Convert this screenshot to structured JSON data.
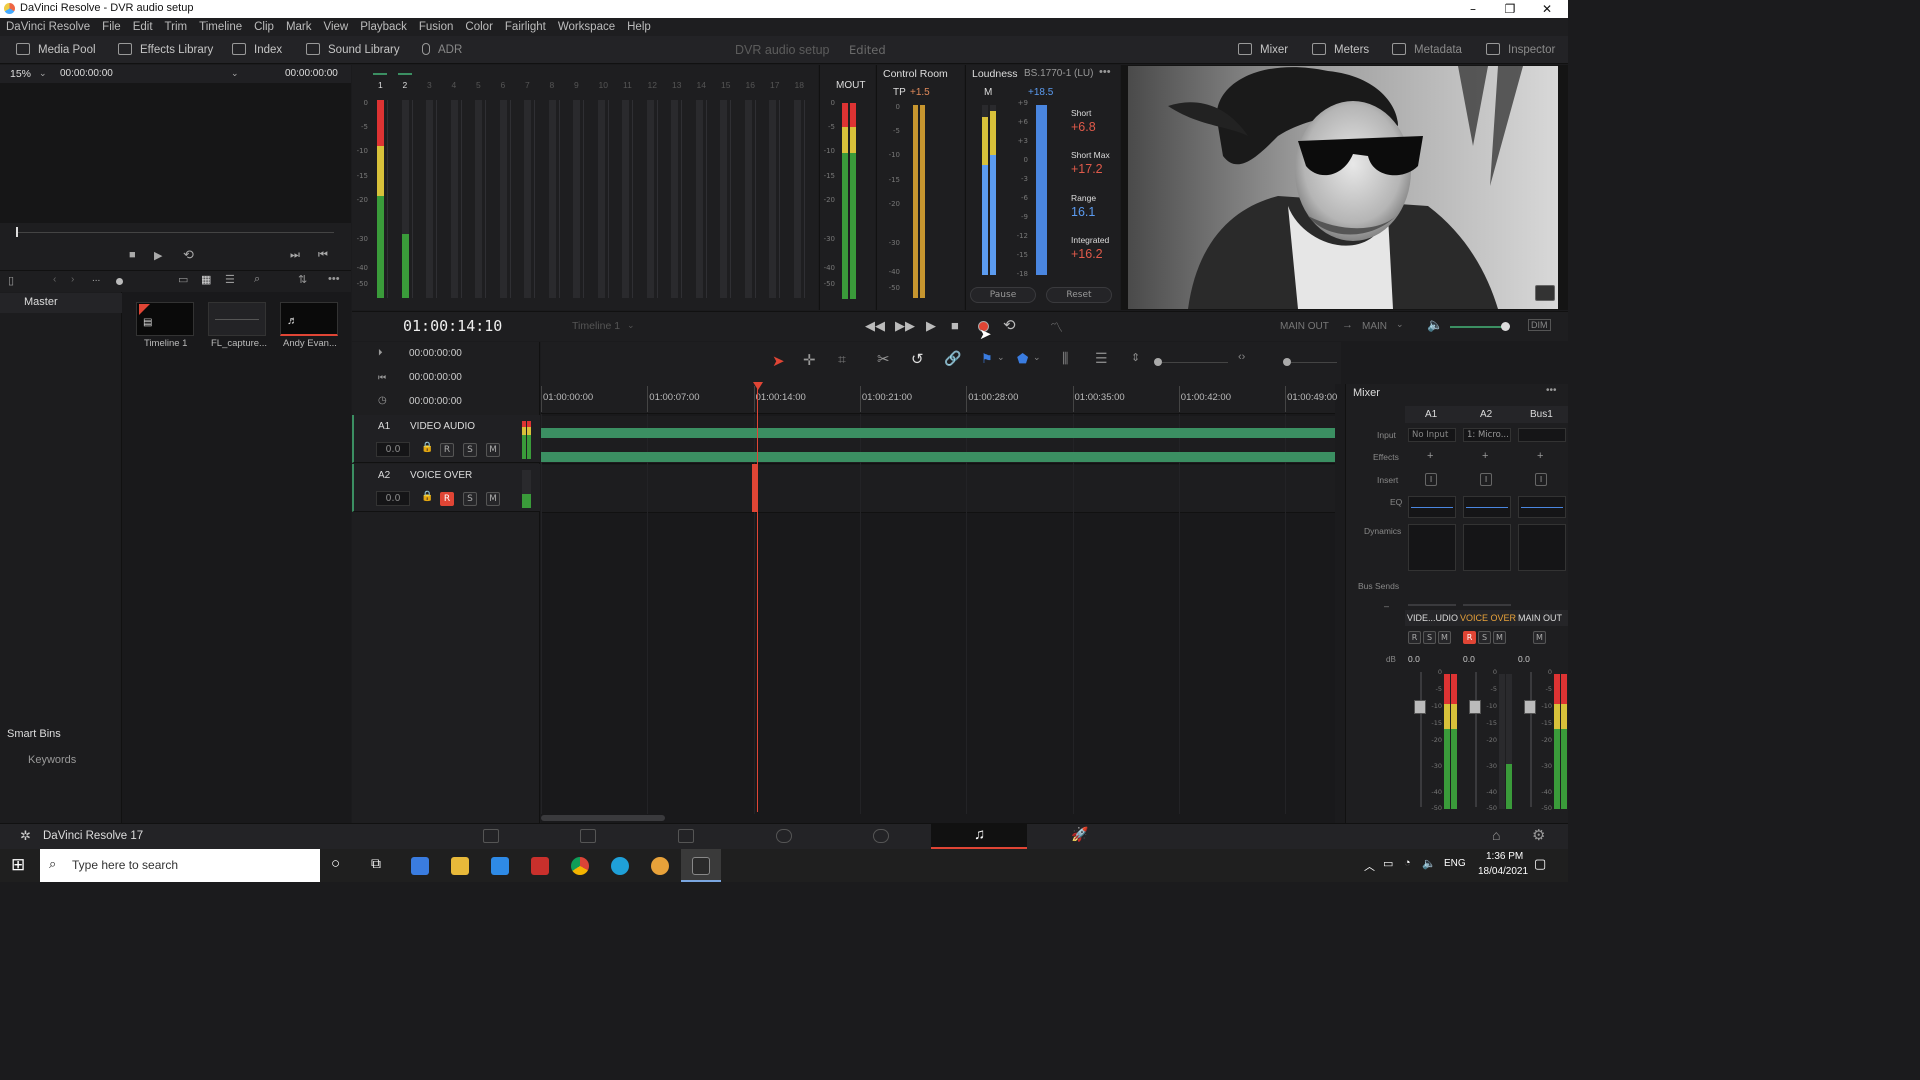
{
  "window": {
    "title": "DaVinci Resolve - DVR audio setup",
    "minimize": "–",
    "maximize": "❐",
    "close": "✕"
  },
  "menu": [
    "DaVinci Resolve",
    "File",
    "Edit",
    "Trim",
    "Timeline",
    "Clip",
    "Mark",
    "View",
    "Playback",
    "Fusion",
    "Color",
    "Fairlight",
    "Workspace",
    "Help"
  ],
  "toolbar": {
    "media_pool": "Media Pool",
    "effects_library": "Effects Library",
    "index": "Index",
    "sound_library": "Sound Library",
    "adr": "ADR",
    "project_title": "DVR audio setup",
    "project_state": "Edited",
    "mixer": "Mixer",
    "meters": "Meters",
    "metadata": "Metadata",
    "inspector": "Inspector"
  },
  "viewer": {
    "zoom": "15%",
    "tc_left": "00:00:00:00",
    "tc_right": "00:00:00:00"
  },
  "bins": {
    "master": "Master",
    "smart_bins": "Smart Bins",
    "keywords": "Keywords",
    "ellipsis": "...",
    "clips": [
      {
        "name": "Timeline 1"
      },
      {
        "name": "FL_capture..."
      },
      {
        "name": "Andy Evan..."
      }
    ]
  },
  "meters": {
    "channel_numbers": [
      "1",
      "2",
      "3",
      "4",
      "5",
      "6",
      "7",
      "8",
      "9",
      "10",
      "11",
      "12",
      "13",
      "14",
      "15",
      "16",
      "17",
      "18"
    ],
    "scale": [
      "0",
      "-5",
      "-10",
      "-15",
      "-20",
      "-30",
      "-40",
      "-50"
    ],
    "mout": "MOUT",
    "control_room": "Control Room",
    "tp_label": "TP",
    "tp_value": "+1.5",
    "loudness": "Loudness",
    "loudness_std": "BS.1770-1 (LU)",
    "m_label": "M",
    "m_value": "+18.5",
    "loud_scale": [
      "+9",
      "+6",
      "+3",
      "0",
      "-3",
      "-6",
      "-9",
      "-12",
      "-15",
      "-18"
    ],
    "short_label": "Short",
    "short_value": "+6.8",
    "short_max_label": "Short Max",
    "short_max_value": "+17.2",
    "range_label": "Range",
    "range_value": "16.1",
    "integrated_label": "Integrated",
    "integrated_value": "+16.2",
    "pause": "Pause",
    "reset": "Reset"
  },
  "transport": {
    "timecode": "01:00:14:10",
    "timeline_name": "Timeline 1",
    "main_out": "MAIN OUT",
    "main": "MAIN",
    "dim": "DIM"
  },
  "timecodes": [
    "00:00:00:00",
    "00:00:00:00",
    "00:00:00:00"
  ],
  "ruler": [
    "01:00:00:00",
    "01:00:07:00",
    "01:00:14:00",
    "01:00:21:00",
    "01:00:28:00",
    "01:00:35:00",
    "01:00:42:00",
    "01:00:49:00"
  ],
  "tracks": [
    {
      "id": "A1",
      "name": "VIDEO AUDIO",
      "level": "0.0",
      "r": "R",
      "s": "S",
      "m": "M"
    },
    {
      "id": "A2",
      "name": "VOICE OVER",
      "level": "0.0",
      "r": "R",
      "s": "S",
      "m": "M"
    }
  ],
  "mixer": {
    "title": "Mixer",
    "more": "•••",
    "columns": [
      "A1",
      "A2",
      "Bus1"
    ],
    "row_labels": {
      "input": "Input",
      "effects": "Effects",
      "insert": "Insert",
      "eq": "EQ",
      "dynamics": "Dynamics",
      "bus_sends": "Bus Sends",
      "db": "dB",
      "dash": "–"
    },
    "inputs": [
      "No Input",
      "1: Micro...",
      ""
    ],
    "plus": "+",
    "insert_glyph": "I",
    "strip_names": [
      "VIDE...UDIO",
      "VOICE OVER",
      "MAIN OUT"
    ],
    "levels": [
      "0.0",
      "0.0",
      "0.0"
    ],
    "r": "R",
    "s": "S",
    "m": "M",
    "fader_scale": [
      "0",
      "-5",
      "-10",
      "-15",
      "-20",
      "-30",
      "-40",
      "-50"
    ]
  },
  "footer": {
    "app": "DaVinci Resolve 17"
  },
  "taskbar": {
    "search": "Type here to search",
    "lang": "ENG",
    "time": "1:36 PM",
    "date": "18/04/2021"
  },
  "colors": {
    "accent_red": "#e04535",
    "loud_red": "#e05a4a",
    "loud_blue": "#5b9bf0",
    "track_green": "#3b8f62",
    "tp_value": "#e08a5a"
  }
}
